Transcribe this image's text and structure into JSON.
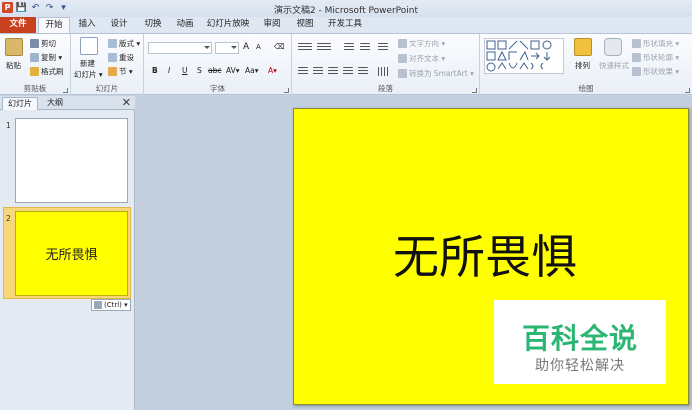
{
  "window": {
    "title": "演示文稿2 - Microsoft PowerPoint",
    "app_icon": "P"
  },
  "qat": {
    "save": "💾",
    "undo": "↶",
    "redo": "↷",
    "customize": "▾"
  },
  "tabs": {
    "file": "文件",
    "home": "开始",
    "insert": "插入",
    "design": "设计",
    "transitions": "切换",
    "animations": "动画",
    "slideshow": "幻灯片放映",
    "review": "审阅",
    "view": "视图",
    "developer": "开发工具"
  },
  "ribbon": {
    "clipboard": {
      "label": "剪贴板",
      "paste": "粘贴",
      "cut": "剪切",
      "copy": "复制 ▾",
      "format_painter": "格式刷"
    },
    "slides": {
      "label": "幻灯片",
      "new_slide": "新建",
      "new_slide2": "幻灯片 ▾",
      "layout": "版式 ▾",
      "reset": "重设",
      "section": "节 ▾"
    },
    "font": {
      "label": "字体",
      "grow": "A",
      "shrink": "A",
      "clear": "⌫",
      "bold": "B",
      "italic": "I",
      "underline": "U",
      "strike": "S",
      "shadow": "abc",
      "spacing": "AV▾",
      "case": "Aa▾",
      "color": "A▾"
    },
    "paragraph": {
      "label": "段落",
      "text_direction": "文字方向 ▾",
      "align_text": "对齐文本 ▾",
      "smartart": "转换为 SmartArt ▾"
    },
    "drawing": {
      "label": "绘图",
      "arrange": "排列",
      "quick_styles": "快速样式",
      "shape_fill": "形状填充 ▾",
      "shape_outline": "形状轮廓 ▾",
      "shape_effects": "形状效果 ▾"
    }
  },
  "panel": {
    "tab_slides": "幻灯片",
    "tab_outline": "大纲",
    "close": "✕",
    "slide1_num": "1",
    "slide2_num": "2",
    "slide2_text": "无所畏惧",
    "paste_options": "(Ctrl) ▾"
  },
  "slide": {
    "title": "无所畏惧"
  },
  "watermark": {
    "line1": "百科全说",
    "line2": "助你轻松解决"
  },
  "colors": {
    "slide_bg": "#ffff00",
    "file_tab": "#c9401f",
    "watermark_green": "#2bb673"
  }
}
